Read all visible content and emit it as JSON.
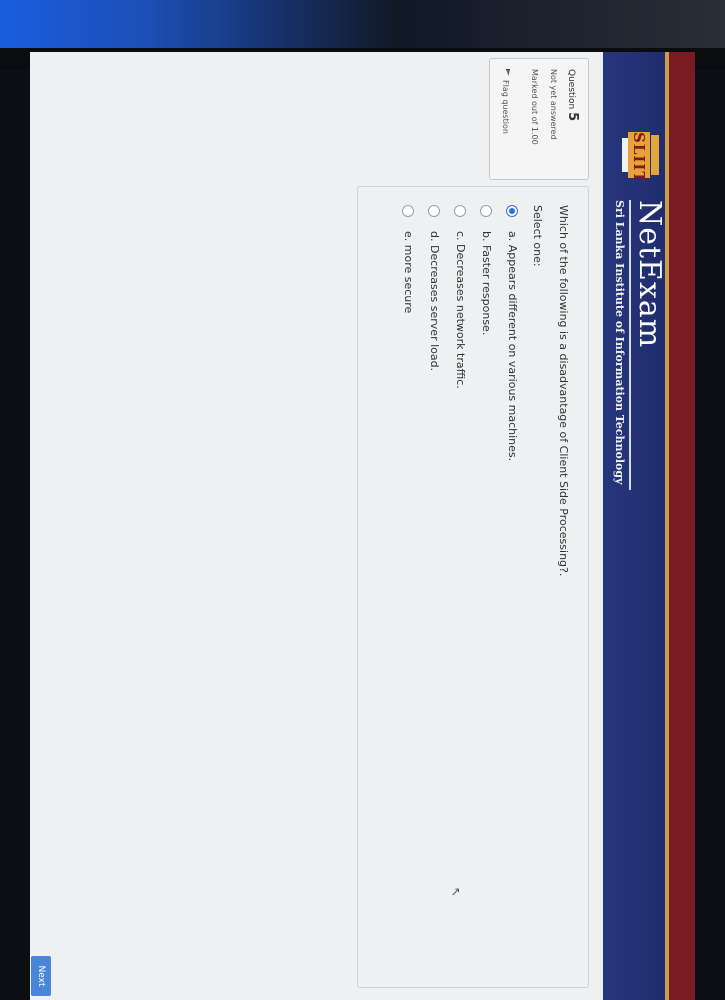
{
  "header": {
    "logo_text": "SLIIT",
    "brand": "NetExam",
    "tagline": "Sri Lanka Institute of Information Technology"
  },
  "question_info": {
    "label": "Question",
    "number": "5",
    "state": "Not yet answered",
    "marks": "Marked out of 1.00",
    "flag": "Flag question",
    "flag_icon": "flag-icon"
  },
  "question": {
    "text": "Which of the following is a disadvantage of Client Side Processing?.",
    "prompt": "Select one:",
    "selected": "a",
    "options": [
      {
        "key": "a",
        "label": "a. Appears different on various machines."
      },
      {
        "key": "b",
        "label": "b. Faster response."
      },
      {
        "key": "c",
        "label": "c. Decreases network traffic."
      },
      {
        "key": "d",
        "label": "d. Decreases server load."
      },
      {
        "key": "e",
        "label": "e. more secure"
      }
    ]
  },
  "navigation": {
    "next_label": "Next"
  },
  "colors": {
    "header_blue": "#27367c",
    "header_red": "#7a1a22",
    "accent_gold": "#c9a14a",
    "radio_selected": "#2b6fd6",
    "next_button": "#4a86d8"
  }
}
